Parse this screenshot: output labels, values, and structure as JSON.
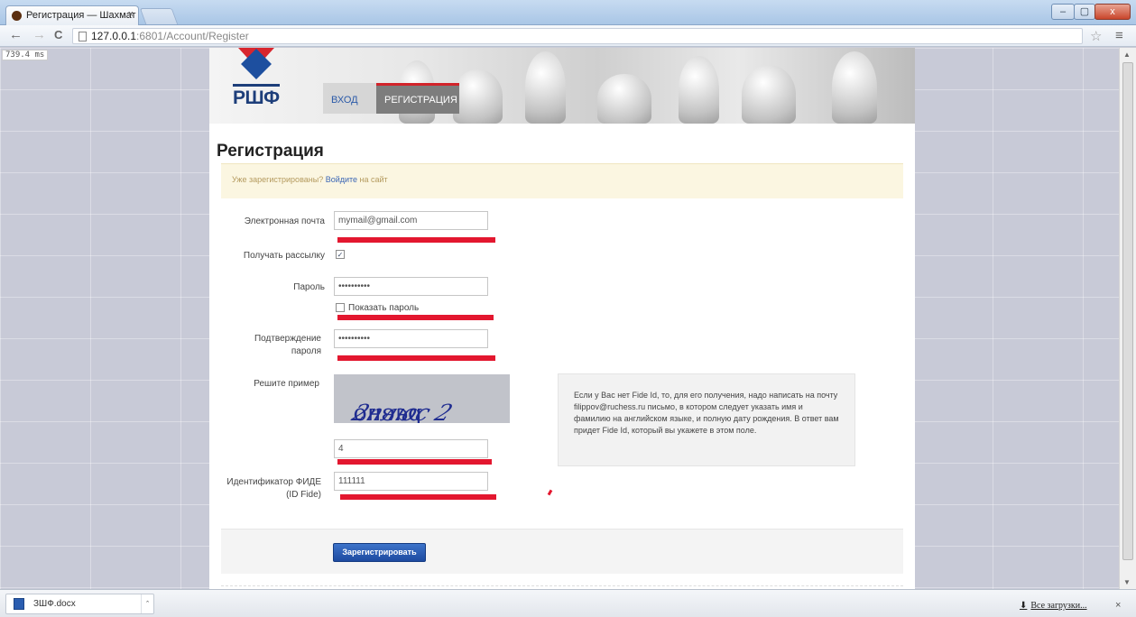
{
  "browser": {
    "tab_title": "Регистрация — Шахмат",
    "tab_close": "×",
    "url_host": "127.0.0.1",
    "url_path": ":6801/Account/Register",
    "back": "←",
    "forward": "→",
    "reload": "C",
    "star": "☆",
    "menu": "≡",
    "window_minimize": "–",
    "window_maximize": "▢",
    "window_close": "x",
    "timing": "739.4 ms"
  },
  "site": {
    "logo_text": "РШФ",
    "nav": {
      "login": "Вход",
      "register": "Регистрация"
    }
  },
  "form": {
    "title": "Регистрация",
    "notice_prefix": "Уже зарегистрированы? ",
    "notice_link": "Войдите",
    "notice_suffix": " на сайт",
    "email_label": "Электронная почта",
    "email_value": "mymail@gmail.com",
    "newsletter_label": "Получать рассылку",
    "newsletter_checked": "✓",
    "password_label": "Пароль",
    "password_value": "••••••••••",
    "show_password_label": "Показать пароль",
    "confirm_label_line1": "Подтверждение",
    "confirm_label_line2": "пароля",
    "confirm_value": "••••••••••",
    "captcha_label": "Решите пример",
    "captcha_text_main": "2плюс 2 ",
    "captcha_text_mirrored": "равно",
    "captcha_answer": "4",
    "fide_label_line1": "Идентификатор ФИДЕ",
    "fide_label_line2": "(ID Fide)",
    "fide_value": "111111",
    "fide_help": "Если у Вас нет Fide Id, то, для его получения, надо написать на почту filippov@ruchess.ru письмо, в котором следует указать имя и фамилию на английском языке, и полную дату рождения. В ответ вам придет Fide Id, который вы укажете в этом поле.",
    "submit_label": "Зарегистрировать"
  },
  "downloads": {
    "file_name": "ЗШФ.docx",
    "all_downloads": "Все загрузки...",
    "close": "×"
  }
}
